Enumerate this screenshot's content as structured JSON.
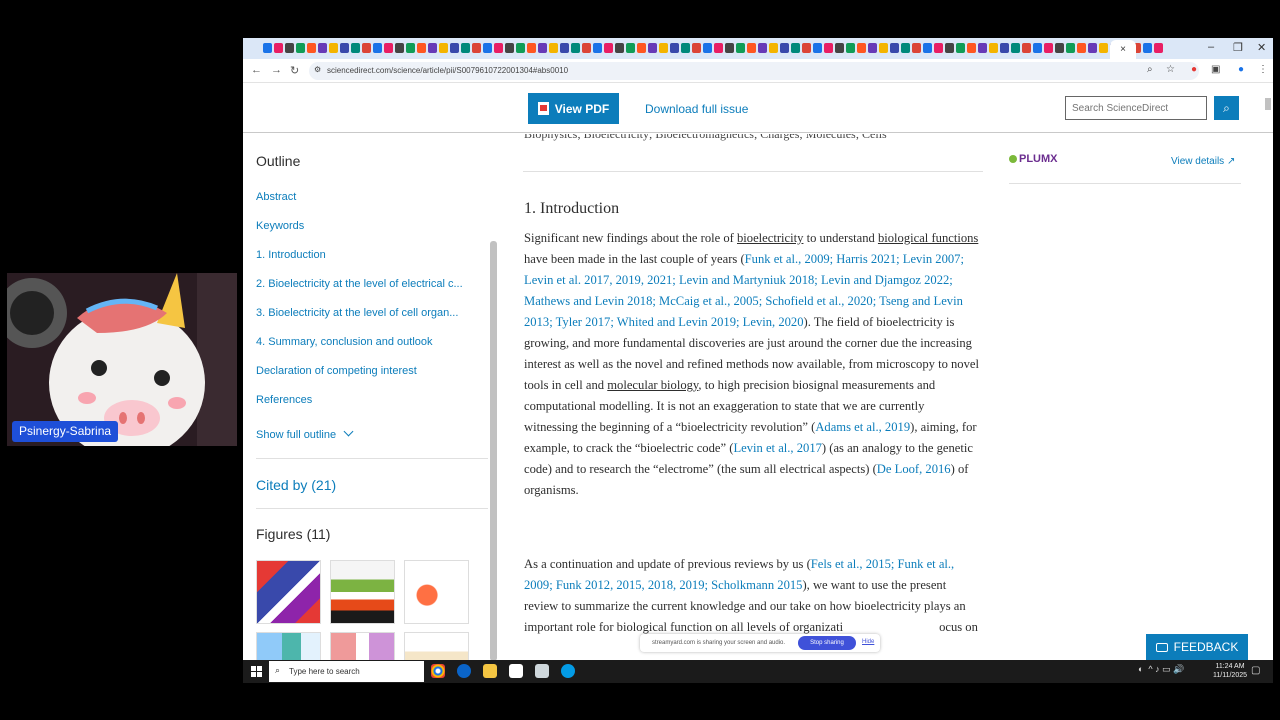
{
  "browser": {
    "active_tab_close": "×",
    "url": "sciencedirect.com/science/article/pii/S0079610722001304#abs0010",
    "window_controls": [
      "–",
      "❐",
      "✕"
    ]
  },
  "site_header": {
    "view_pdf": "View PDF",
    "download": "Download full issue",
    "search_placeholder": "Search ScienceDirect"
  },
  "outline": {
    "title": "Outline",
    "items": [
      "Abstract",
      "Keywords",
      "1. Introduction",
      "2. Bioelectricity at the level of electrical c...",
      "3. Bioelectricity at the level of cell organ...",
      "4. Summary, conclusion and outlook",
      "Declaration of competing interest",
      "References"
    ],
    "show_full": "Show full outline",
    "cited_by": "Cited by (21)",
    "figures": "Figures (11)"
  },
  "article": {
    "keywords_line": "Biophysics; Bioelectricity; Bioelectromagnetics; Charges; Molecules; Cells",
    "heading": "1. Introduction",
    "p1": {
      "t1": "Significant new findings about the role of ",
      "kw1": "bioelectricity",
      "t2": " to understand ",
      "kw2": "biological functions",
      "t3": " have been made in the last couple of years (",
      "refs1": "Funk et al., 2009; Harris 2021; Levin 2007; Levin et al. 2017, 2019, 2021; Levin and Martyniuk 2018; Levin and Djamgoz 2022; Mathews and Levin 2018; McCaig et al., 2005; Schofield et al., 2020; Tseng and Levin 2013; Tyler 2017; Whited and Levin 2019; Levin, 2020",
      "t4": "). The field of bioelectricity is growing, and more fundamental discoveries are just around the corner due the increasing interest as well as the novel and refined methods now available, from microscopy to novel tools in cell and ",
      "kw3": "molecular biology",
      "t5": ", to high precision biosignal measurements and computational modelling. It is not an exaggeration to state that we are currently witnessing the beginning of a “bioelectricity revolution” (",
      "ref2": "Adams et al., 2019",
      "t6": "), aiming, for example, to crack the “bioelectric code” (",
      "ref3": "Levin et al., 2017",
      "t7": ") (as an analogy to the genetic code) and to research the “electrome” (the sum all electrical aspects) (",
      "ref4": "De Loof, 2016",
      "t8": ") of organisms."
    },
    "p2": {
      "t1": "As a continuation and update of previous reviews by us (",
      "refs": "Fels et al., 2015; Funk et al., 2009; Funk 2012, 2015, 2018, 2019; Scholkmann 2015",
      "t2": "), we want to use the present review to summarize the current knowledge and our take on how bioelectricity plays an important role for biological function on all levels of organizati",
      "t3": "ocus on"
    }
  },
  "right_column": {
    "plumx": "PLUMX",
    "view_details": "View details ↗"
  },
  "share_bar": {
    "text": "streamyard.com is sharing your screen and audio.",
    "stop": "Stop sharing",
    "hide": "Hide"
  },
  "feedback": "FEEDBACK",
  "taskbar": {
    "search_placeholder": "Type here to search",
    "time": "11:24 AM",
    "date": "11/11/2025"
  },
  "webcam": {
    "name": "Psinergy-Sabrina"
  },
  "colors": {
    "accent": "#0c7dbb",
    "plumx": "#6b2d8f"
  }
}
